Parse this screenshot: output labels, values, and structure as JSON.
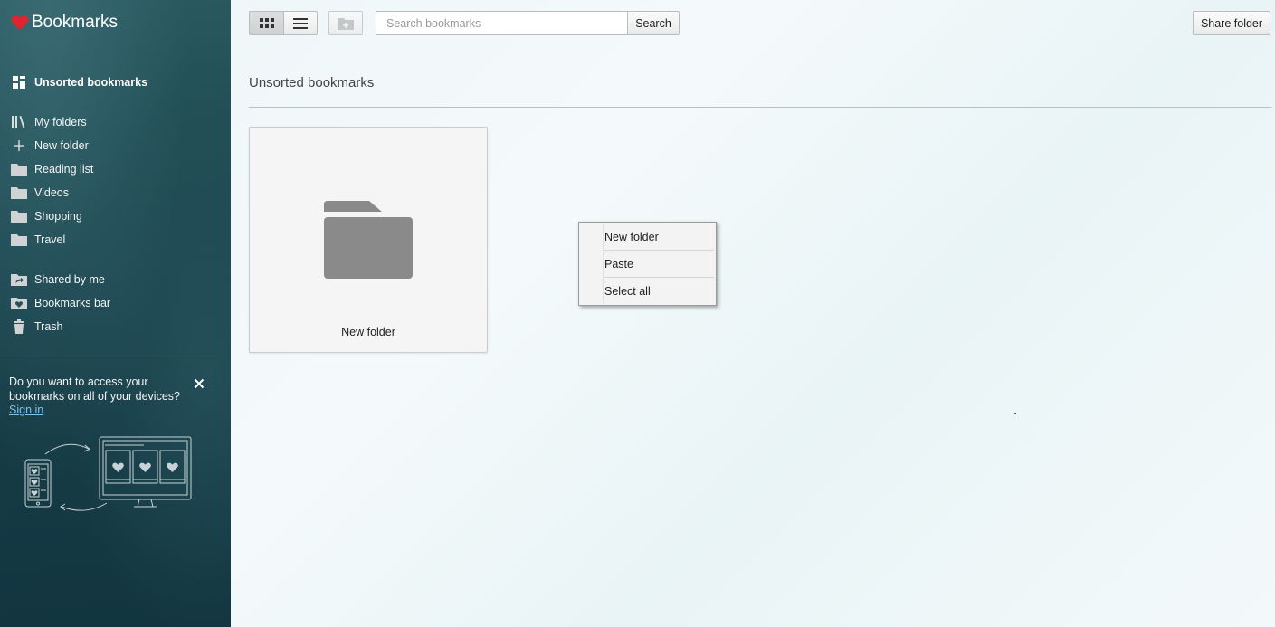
{
  "app": {
    "title": "Bookmarks",
    "brand_color": "#e0232c"
  },
  "sidebar": {
    "primary": {
      "label": "Unsorted bookmarks",
      "icon": "tiles-icon"
    },
    "items": [
      {
        "label": "My folders",
        "icon": "library-icon"
      },
      {
        "label": "New folder",
        "icon": "plus-icon"
      },
      {
        "label": "Reading list",
        "icon": "folder-icon"
      },
      {
        "label": "Videos",
        "icon": "folder-icon"
      },
      {
        "label": "Shopping",
        "icon": "folder-icon"
      },
      {
        "label": "Travel",
        "icon": "folder-icon"
      },
      {
        "label": "Shared by me",
        "icon": "shared-folder-icon"
      },
      {
        "label": "Bookmarks bar",
        "icon": "heart-folder-icon"
      },
      {
        "label": "Trash",
        "icon": "trash-icon"
      }
    ],
    "promo": {
      "text": "Do you want to access your bookmarks on all of your devices?",
      "link": "Sign in"
    }
  },
  "toolbar": {
    "search_placeholder": "Search bookmarks",
    "search_value": "",
    "search_button": "Search",
    "share_button": "Share folder",
    "active_view": "grid"
  },
  "main": {
    "title": "Unsorted bookmarks",
    "cards": [
      {
        "label": "New folder",
        "icon": "folder-icon"
      }
    ]
  },
  "context_menu": {
    "items": [
      "New folder",
      "Paste",
      "Select all"
    ]
  }
}
